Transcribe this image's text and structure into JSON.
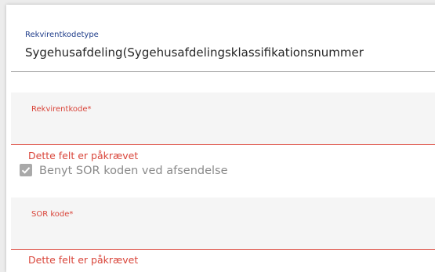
{
  "colors": {
    "label": "#1f3d8a",
    "required_label": "#d9453a",
    "error": "#d9453a"
  },
  "requisition_type": {
    "label": "Rekvirentkodetype",
    "value": "Sygehusafdeling(Sygehusafdelingsklassifikationsnummer"
  },
  "requisition_code": {
    "label": "Rekvirentkode*",
    "value": "",
    "error": "Dette felt er påkrævet"
  },
  "use_sor": {
    "label": "Benyt SOR koden ved afsendelse",
    "checked": true,
    "icon": "check-icon"
  },
  "sor_code": {
    "label": "SOR kode*",
    "value": "",
    "error": "Dette felt er påkrævet"
  }
}
